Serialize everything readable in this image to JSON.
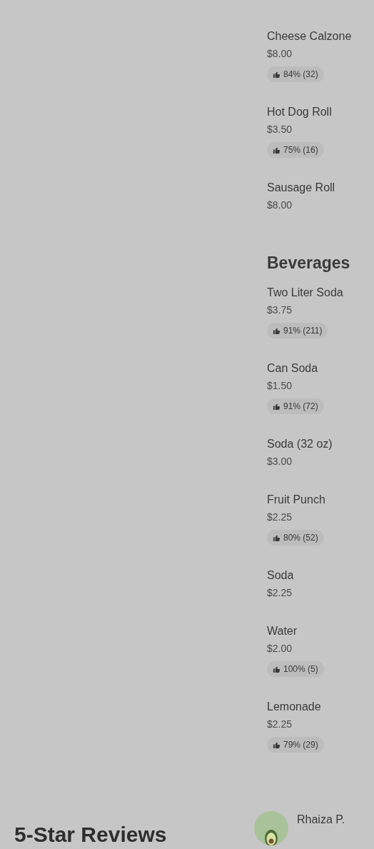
{
  "menu_sections": [
    {
      "items": [
        {
          "name": "Cheese Calzone",
          "price": "$8.00",
          "rating": "84% (32)"
        },
        {
          "name": "Hot Dog Roll",
          "price": "$3.50",
          "rating": "75% (16)"
        },
        {
          "name": "Sausage Roll",
          "price": "$8.00"
        }
      ]
    },
    {
      "title": "Beverages",
      "items": [
        {
          "name": "Two Liter Soda",
          "price": "$3.75",
          "rating": "91% (211)"
        },
        {
          "name": "Can Soda",
          "price": "$1.50",
          "rating": "91% (72)"
        },
        {
          "name": "Soda (32 oz)",
          "price": "$3.00"
        },
        {
          "name": "Fruit Punch",
          "price": "$2.25",
          "rating": "80% (52)"
        },
        {
          "name": "Soda",
          "price": "$2.25"
        },
        {
          "name": "Water",
          "price": "$2.00",
          "rating": "100% (5)"
        },
        {
          "name": "Lemonade",
          "price": "$2.25",
          "rating": "79% (29)"
        }
      ]
    }
  ],
  "reviews": {
    "title": "5-Star Reviews",
    "reviewers": [
      {
        "name": "Rhaiza P."
      }
    ]
  }
}
